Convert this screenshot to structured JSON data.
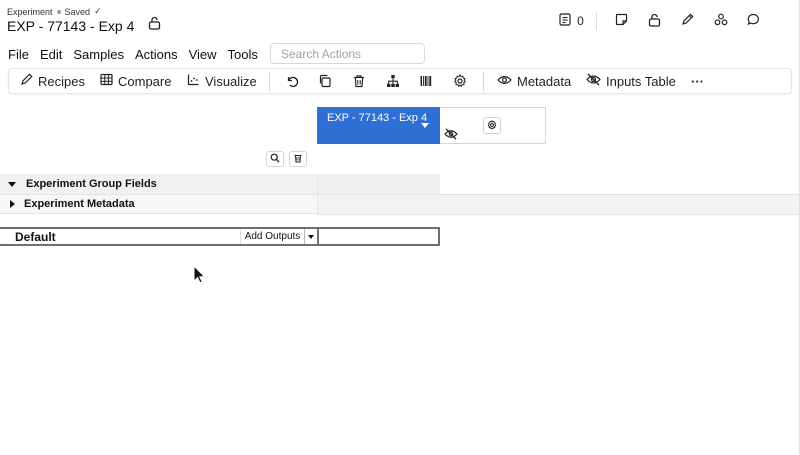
{
  "header": {
    "breadcrumb_type": "Experiment",
    "save_status": "Saved",
    "save_check": "✓",
    "title": "EXP - 77143 - Exp 4",
    "comment_count": "0"
  },
  "menubar": {
    "items": [
      "File",
      "Edit",
      "Samples",
      "Actions",
      "View",
      "Tools"
    ],
    "search_placeholder": "Search Actions"
  },
  "toolbar": {
    "recipes_label": "Recipes",
    "compare_label": "Compare",
    "visualize_label": "Visualize",
    "metadata_label": "Metadata",
    "inputs_table_label": "Inputs Table",
    "more_label": "···"
  },
  "grid": {
    "column_header": "EXP - 77143 - Exp 4",
    "groups": [
      {
        "label": "Experiment Group Fields",
        "expanded": true
      },
      {
        "label": "Experiment Metadata",
        "expanded": false
      }
    ],
    "default_section": {
      "label": "Default",
      "add_outputs_label": "Add Outputs"
    }
  },
  "colors": {
    "accent": "#2f6fd4",
    "row_bg": "#f1f1f1",
    "border": "#d6d6d6"
  }
}
